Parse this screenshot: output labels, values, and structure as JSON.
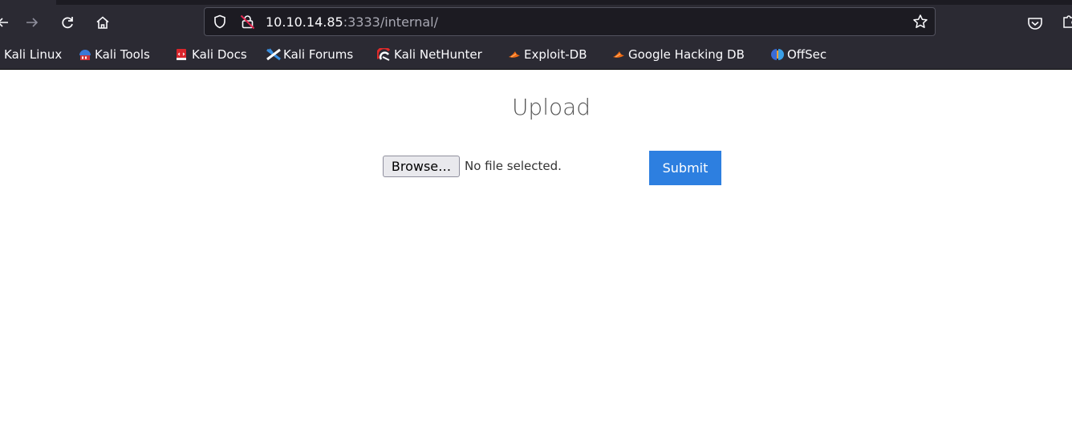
{
  "browser": {
    "url_host": "10.10.14.85",
    "url_rest": ":3333/internal/",
    "icons": {
      "back": "arrow-left-icon",
      "forward": "arrow-right-icon",
      "reload": "reload-icon",
      "home": "home-icon",
      "shield": "shield-icon",
      "lock": "insecure-lock-icon",
      "star": "star-icon",
      "pocket": "pocket-icon",
      "extensions": "puzzle-icon"
    }
  },
  "bookmarks": [
    {
      "label": "Kali Linux"
    },
    {
      "label": "Kali Tools"
    },
    {
      "label": "Kali Docs"
    },
    {
      "label": "Kali Forums"
    },
    {
      "label": "Kali NetHunter"
    },
    {
      "label": "Exploit-DB"
    },
    {
      "label": "Google Hacking DB"
    },
    {
      "label": "OffSec"
    }
  ],
  "page": {
    "title": "Upload",
    "browse_label": "Browse…",
    "file_status": "No file selected.",
    "submit_label": "Submit"
  },
  "colors": {
    "chrome_bg": "#2b2a33",
    "submit_bg": "#2d7fe0"
  }
}
